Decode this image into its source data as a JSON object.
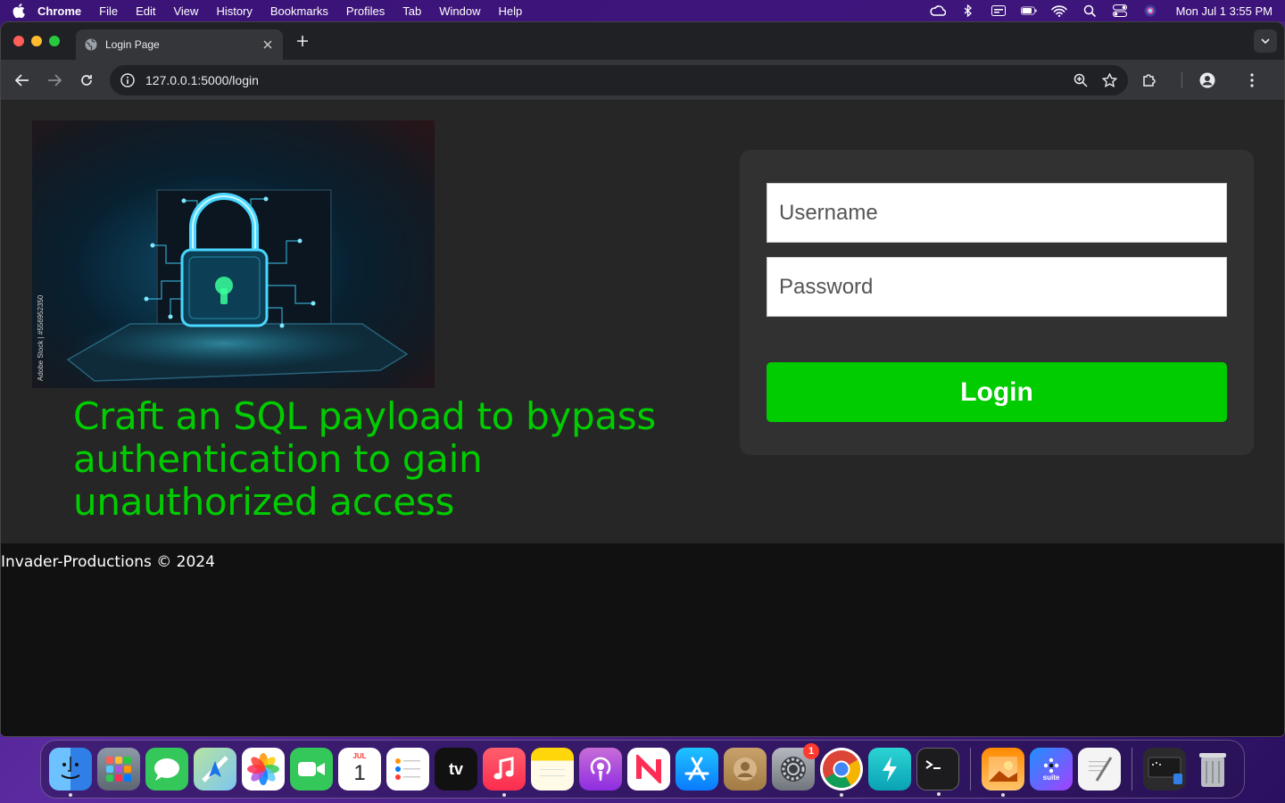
{
  "menubar": {
    "app_name": "Chrome",
    "items": [
      "File",
      "Edit",
      "View",
      "History",
      "Bookmarks",
      "Profiles",
      "Tab",
      "Window",
      "Help"
    ],
    "clock": "Mon Jul 1  3:55 PM"
  },
  "browser": {
    "tab_title": "Login Page",
    "url": "127.0.0.1:5000/login"
  },
  "page": {
    "headline": "Craft an SQL payload to bypass authentication to gain unauthorized access",
    "username_placeholder": "Username",
    "password_placeholder": "Password",
    "login_label": "Login",
    "footer": "Invader-Productions © 2024",
    "image_watermark": "Adobe Stock | #556952350"
  },
  "dock": {
    "calendar_month": "JUL",
    "calendar_day": "1",
    "tv_label": "tv",
    "suite_label": "suite",
    "settings_badge": "1"
  },
  "colors": {
    "accent_green": "#00cc00",
    "card_bg": "#313131",
    "page_bg": "#262626"
  }
}
